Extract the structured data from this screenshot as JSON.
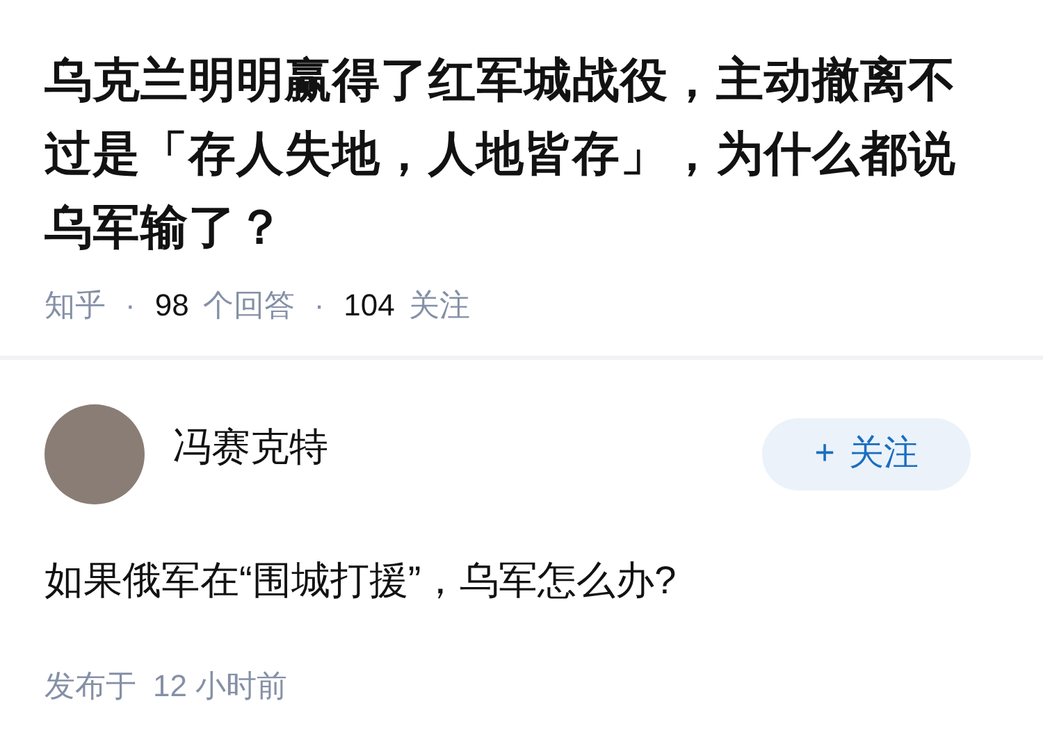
{
  "question": {
    "title": "乌克兰明明赢得了红军城战役，主动撤离不过是「存人失地，人地皆存」，为什么都说乌军输了？",
    "meta": {
      "source": "知乎",
      "separator_1": "·",
      "answers_count": "98",
      "answers_label": "个回答",
      "separator_2": "·",
      "followers_count": "104",
      "followers_label": "关注"
    }
  },
  "answer": {
    "author": {
      "name": "冯赛克特"
    },
    "follow_button": {
      "plus": "+",
      "label": "关注"
    },
    "text": "如果俄军在“围城打援”，乌军怎么办?",
    "published_label": "发布于",
    "published_time": "12 小时前"
  }
}
